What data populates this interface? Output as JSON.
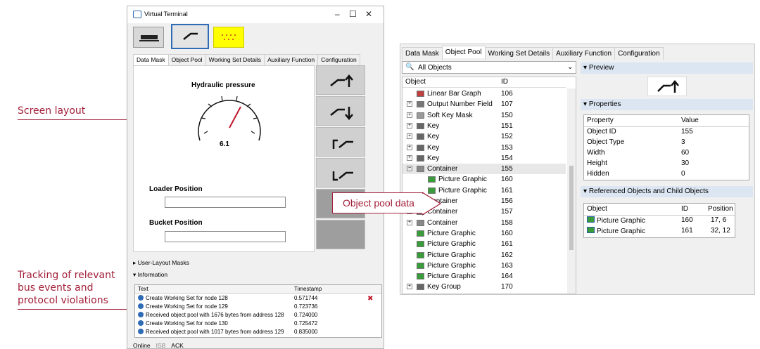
{
  "annotations": {
    "screen_layout": "Screen layout",
    "tracking_line1": "Tracking of relevant",
    "tracking_line2": "bus events and",
    "tracking_line3": "protocol violations",
    "object_pool_data": "Object pool data"
  },
  "vt": {
    "title": "Virtual Terminal",
    "minimize": "–",
    "maximize": "☐",
    "close": "✕",
    "tabs": [
      "Data Mask",
      "Object Pool",
      "Working Set Details",
      "Auxiliary Function",
      "Configuration"
    ],
    "gauge_title": "Hydraulic pressure",
    "gauge_value": "6.1",
    "loader_label": "Loader Position",
    "bucket_label": "Bucket Position",
    "user_layout": "User-Layout Masks",
    "information": "Information",
    "info_headers": {
      "text": "Text",
      "timestamp": "Timestamp"
    },
    "info_rows": [
      {
        "text": "Create Working Set for node 128",
        "ts": "0.571744"
      },
      {
        "text": "Create Working Set for node 129",
        "ts": "0.723736"
      },
      {
        "text": "Received object pool with 1676 bytes from address 128",
        "ts": "0.724000"
      },
      {
        "text": "Create Working Set for node 130",
        "ts": "0.725472"
      },
      {
        "text": "Received object pool with 1017 bytes from address 129",
        "ts": "0.835000"
      }
    ],
    "status": {
      "online": "Online",
      "isb": "ISB",
      "ack": "ACK"
    }
  },
  "op": {
    "tabs": [
      "Data Mask",
      "Object Pool",
      "Working Set Details",
      "Auxiliary Function",
      "Configuration"
    ],
    "filter": "All Objects",
    "tree_headers": {
      "object": "Object",
      "id": "ID"
    },
    "rows": [
      {
        "name": "Linear Bar Graph",
        "id": "106",
        "exp": "",
        "indent": 0
      },
      {
        "name": "Output Number Field",
        "id": "107",
        "exp": "+",
        "indent": 0
      },
      {
        "name": "Soft Key Mask",
        "id": "150",
        "exp": "+",
        "indent": 0
      },
      {
        "name": "Key",
        "id": "151",
        "exp": "+",
        "indent": 0
      },
      {
        "name": "Key",
        "id": "152",
        "exp": "+",
        "indent": 0
      },
      {
        "name": "Key",
        "id": "153",
        "exp": "+",
        "indent": 0
      },
      {
        "name": "Key",
        "id": "154",
        "exp": "+",
        "indent": 0
      },
      {
        "name": "Container",
        "id": "155",
        "exp": "−",
        "indent": 0
      },
      {
        "name": "Picture Graphic",
        "id": "160",
        "exp": "",
        "indent": 1
      },
      {
        "name": "Picture Graphic",
        "id": "161",
        "exp": "",
        "indent": 1
      },
      {
        "name": "Container",
        "id": "156",
        "exp": "+",
        "indent": 0
      },
      {
        "name": "Container",
        "id": "157",
        "exp": "+",
        "indent": 0
      },
      {
        "name": "Container",
        "id": "158",
        "exp": "+",
        "indent": 0
      },
      {
        "name": "Picture Graphic",
        "id": "160",
        "exp": "",
        "indent": 0
      },
      {
        "name": "Picture Graphic",
        "id": "161",
        "exp": "",
        "indent": 0
      },
      {
        "name": "Picture Graphic",
        "id": "162",
        "exp": "",
        "indent": 0
      },
      {
        "name": "Picture Graphic",
        "id": "163",
        "exp": "",
        "indent": 0
      },
      {
        "name": "Picture Graphic",
        "id": "164",
        "exp": "",
        "indent": 0
      },
      {
        "name": "Key Group",
        "id": "170",
        "exp": "+",
        "indent": 0
      }
    ],
    "preview": "Preview",
    "properties": "Properties",
    "prop_headers": {
      "property": "Property",
      "value": "Value"
    },
    "props": [
      {
        "k": "Object ID",
        "v": "155"
      },
      {
        "k": "Object Type",
        "v": "3"
      },
      {
        "k": "Width",
        "v": "60"
      },
      {
        "k": "Height",
        "v": "30"
      },
      {
        "k": "Hidden",
        "v": "0"
      }
    ],
    "referenced": "Referenced Objects and Child Objects",
    "ref_headers": {
      "object": "Object",
      "id": "ID",
      "position": "Position"
    },
    "refs": [
      {
        "o": "Picture Graphic",
        "id": "160",
        "pos": "17, 6"
      },
      {
        "o": "Picture Graphic",
        "id": "161",
        "pos": "32, 12"
      }
    ]
  }
}
